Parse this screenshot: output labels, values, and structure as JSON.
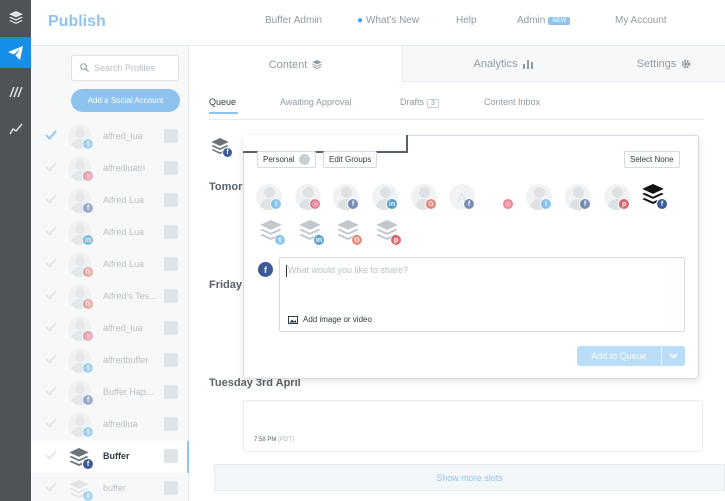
{
  "app": {
    "title": "Publish"
  },
  "topnav": {
    "items": [
      {
        "label": "Buffer Admin"
      },
      {
        "label": "What's New"
      },
      {
        "label": "Help"
      },
      {
        "label": "Admin",
        "badge": "NEW"
      },
      {
        "label": "My Account"
      }
    ]
  },
  "rail": {
    "icons": [
      "layers-icon",
      "paper-plane-icon",
      "reply-icon",
      "analytics-line-icon"
    ]
  },
  "sidebar": {
    "search_placeholder": "Search Profiles",
    "add_account_label": "Add a Social Account",
    "profiles": [
      {
        "name": "alfred_lua",
        "network": "twitter",
        "checked": true
      },
      {
        "name": "alfredluatri",
        "network": "instagram",
        "checked": false
      },
      {
        "name": "Alfred Lua",
        "network": "facebook",
        "checked": false
      },
      {
        "name": "Alfred Lua",
        "network": "linkedin",
        "checked": false
      },
      {
        "name": "Alfred Lua",
        "network": "google-plus",
        "checked": false
      },
      {
        "name": "Alfred's Tes...",
        "network": "google-plus",
        "checked": false
      },
      {
        "name": "alfred_lua",
        "network": "instagram",
        "checked": false
      },
      {
        "name": "alfredbuffer",
        "network": "twitter",
        "checked": false
      },
      {
        "name": "Buffer Hap...",
        "network": "facebook",
        "checked": false
      },
      {
        "name": "alfredlua",
        "network": "twitter",
        "checked": false
      },
      {
        "name": "Buffer",
        "network": "facebook",
        "checked": false,
        "active": true
      },
      {
        "name": "buffer",
        "network": "twitter",
        "checked": false
      }
    ]
  },
  "main": {
    "tabs": [
      {
        "label": "Content",
        "active": true
      },
      {
        "label": "Analytics"
      },
      {
        "label": "Settings"
      }
    ],
    "subtabs": [
      {
        "label": "Queue",
        "active": true
      },
      {
        "label": "Awaiting Approval"
      },
      {
        "label": "Drafts",
        "count": "3"
      },
      {
        "label": "Content Inbox"
      }
    ],
    "days": [
      {
        "label": "Tomor"
      },
      {
        "label": "Friday"
      },
      {
        "label": "Tuesday 3rd April"
      }
    ],
    "slot": {
      "time": "7:58 PM",
      "tz": "(PDT)"
    },
    "show_more_label": "Show more slots"
  },
  "composer": {
    "groups": [
      {
        "label": "Personal"
      },
      {
        "label": "Edit Groups"
      }
    ],
    "select_none_label": "Select None",
    "text_placeholder": "What would you like to share?",
    "add_media_label": "Add image or video",
    "add_to_queue_label": "Add to Queue",
    "network_colors": {
      "twitter": "#55acee",
      "instagram": "#e4405f",
      "facebook": "#3b5998",
      "linkedin": "#0077b5",
      "google-plus": "#dd4b39",
      "pinterest": "#cb2027"
    }
  }
}
